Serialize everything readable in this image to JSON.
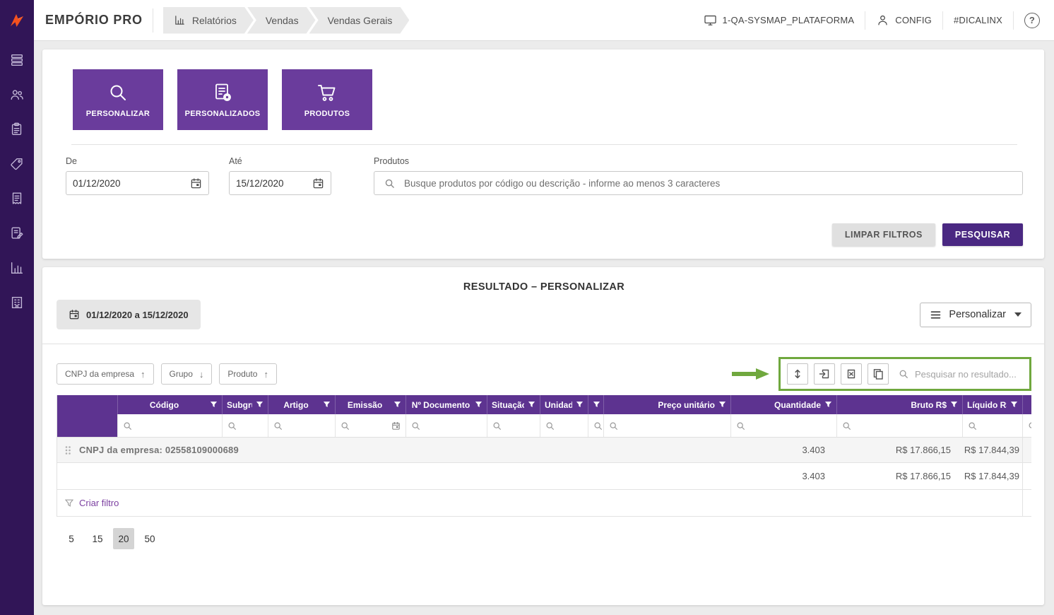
{
  "header": {
    "app_name": "EMPÓRIO PRO",
    "breadcrumb": {
      "item1": "Relatórios",
      "item2": "Vendas",
      "item3": "Vendas Gerais"
    },
    "platform": "1-QA-SYSMAP_PLATAFORMA",
    "config": "CONFIG",
    "hashtag": "#DICALINX",
    "help": "?"
  },
  "filters": {
    "tile1": "PERSONALIZAR",
    "tile2": "PERSONALIZADOS",
    "tile3": "PRODUTOS",
    "de_label": "De",
    "de_value": "01/12/2020",
    "ate_label": "Até",
    "ate_value": "15/12/2020",
    "produtos_label": "Produtos",
    "produtos_placeholder": "Busque produtos por código ou descrição - informe ao menos 3 caracteres",
    "limpar": "LIMPAR FILTROS",
    "pesquisar": "PESQUISAR"
  },
  "result": {
    "title": "RESULTADO – PERSONALIZAR",
    "date_range": "01/12/2020 a 15/12/2020",
    "personalizar": "Personalizar",
    "chips": {
      "c1": {
        "label": "CNPJ da empresa",
        "arrow": "↑"
      },
      "c2": {
        "label": "Grupo",
        "arrow": "↓"
      },
      "c3": {
        "label": "Produto",
        "arrow": "↑"
      }
    },
    "search_placeholder": "Pesquisar no resultado...",
    "columns": {
      "codigo": "Código",
      "subgrupo": "Subgru...",
      "artigo": "Artigo",
      "emissao": "Emissão",
      "documento": "Nº Documento",
      "situacao": "Situação",
      "unidade": "Unidade",
      "preco": "Preço unitário",
      "quantidade": "Quantidade",
      "bruto": "Bruto R$",
      "liquido": "Líquido R$"
    },
    "group_row": {
      "label": "CNPJ da empresa: 02558109000689",
      "quantidade": "3.403",
      "bruto": "R$ 17.866,15",
      "liquido": "R$ 17.844,39"
    },
    "total_row": {
      "quantidade": "3.403",
      "bruto": "R$ 17.866,15",
      "liquido": "R$ 17.844,39"
    },
    "criar_filtro": "Criar filtro",
    "page_sizes": {
      "s1": "5",
      "s2": "15",
      "s3": "20",
      "s4": "50"
    }
  }
}
